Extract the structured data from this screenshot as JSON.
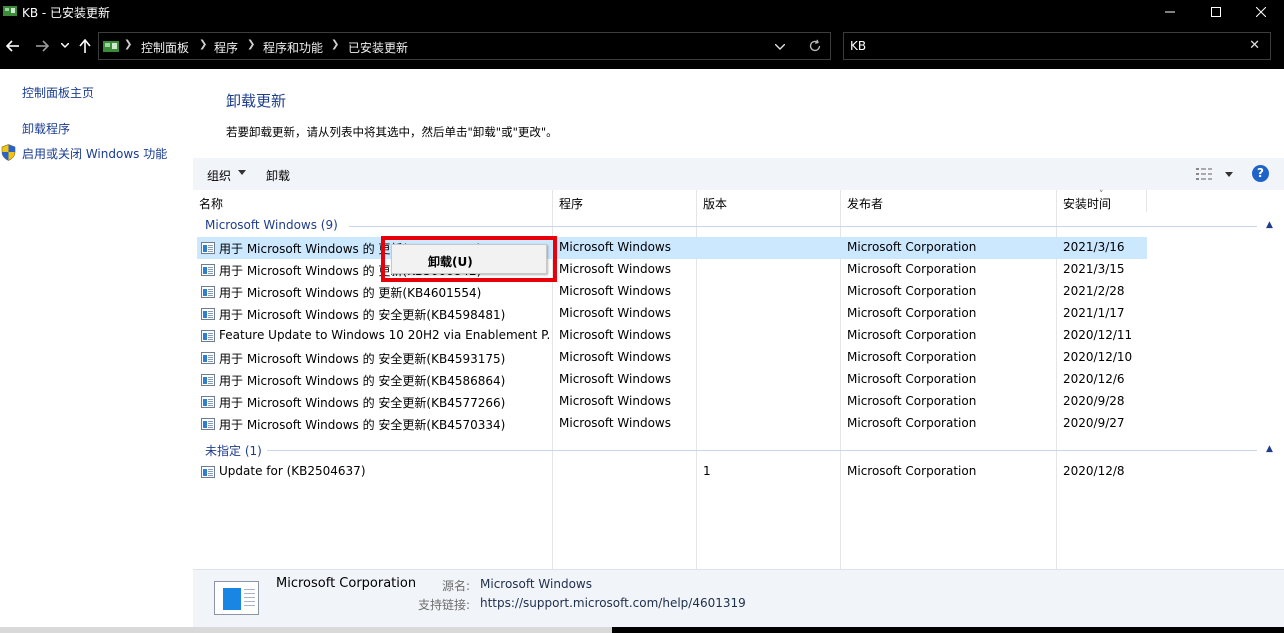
{
  "window": {
    "title": "KB - 已安装更新"
  },
  "address_bar": {
    "crumbs": [
      "控制面板",
      "程序",
      "程序和功能",
      "已安装更新"
    ]
  },
  "search": {
    "value": "KB"
  },
  "sidebar": {
    "items": [
      {
        "label": "控制面板主页"
      },
      {
        "label": "卸载程序"
      },
      {
        "label": "启用或关闭 Windows 功能",
        "icon": "shield-icon"
      }
    ]
  },
  "main": {
    "heading": "卸载更新",
    "description": "若要卸载更新，请从列表中将其选中，然后单击\"卸载\"或\"更改\"。"
  },
  "toolbar": {
    "organize_label": "组织",
    "uninstall_label": "卸载",
    "help_label": "?"
  },
  "columns": {
    "name": "名称",
    "program": "程序",
    "version": "版本",
    "publisher": "发布者",
    "installed_on": "安装时间"
  },
  "groups": [
    {
      "label": "Microsoft Windows (9)",
      "rows": [
        {
          "name": "用于 Microsoft Windows 的 更新(KB4601319)",
          "program": "Microsoft Windows",
          "version": "",
          "publisher": "Microsoft Corporation",
          "date": "2021/3/16",
          "selected": true
        },
        {
          "name": "用于 Microsoft Windows 的 更新(KB5000842)",
          "program": "Microsoft Windows",
          "version": "",
          "publisher": "Microsoft Corporation",
          "date": "2021/3/15"
        },
        {
          "name": "用于 Microsoft Windows 的 更新(KB4601554)",
          "program": "Microsoft Windows",
          "version": "",
          "publisher": "Microsoft Corporation",
          "date": "2021/2/28"
        },
        {
          "name": "用于 Microsoft Windows 的 安全更新(KB4598481)",
          "program": "Microsoft Windows",
          "version": "",
          "publisher": "Microsoft Corporation",
          "date": "2021/1/17"
        },
        {
          "name": "Feature Update to Windows 10 20H2 via Enablement P...",
          "program": "Microsoft Windows",
          "version": "",
          "publisher": "Microsoft Corporation",
          "date": "2020/12/11"
        },
        {
          "name": "用于 Microsoft Windows 的 安全更新(KB4593175)",
          "program": "Microsoft Windows",
          "version": "",
          "publisher": "Microsoft Corporation",
          "date": "2020/12/10"
        },
        {
          "name": "用于 Microsoft Windows 的 安全更新(KB4586864)",
          "program": "Microsoft Windows",
          "version": "",
          "publisher": "Microsoft Corporation",
          "date": "2020/12/6"
        },
        {
          "name": "用于 Microsoft Windows 的 安全更新(KB4577266)",
          "program": "Microsoft Windows",
          "version": "",
          "publisher": "Microsoft Corporation",
          "date": "2020/9/28"
        },
        {
          "name": "用于 Microsoft Windows 的 安全更新(KB4570334)",
          "program": "Microsoft Windows",
          "version": "",
          "publisher": "Microsoft Corporation",
          "date": "2020/9/27"
        }
      ]
    },
    {
      "label": "未指定 (1)",
      "rows": [
        {
          "name": "Update for  (KB2504637)",
          "program": "",
          "version": "1",
          "publisher": "Microsoft Corporation",
          "date": "2020/12/8"
        }
      ]
    }
  ],
  "context_menu": {
    "items": [
      "卸载(U)"
    ]
  },
  "details": {
    "publisher": "Microsoft Corporation",
    "source_label": "源名:",
    "source_value": "Microsoft Windows",
    "support_label": "支持链接:",
    "support_value": "https://support.microsoft.com/help/4601319"
  },
  "colors": {
    "selection": "#cce8ff",
    "context_highlight": "#e8000b",
    "link": "#1a3d8f",
    "heading": "#1e3d8c"
  }
}
